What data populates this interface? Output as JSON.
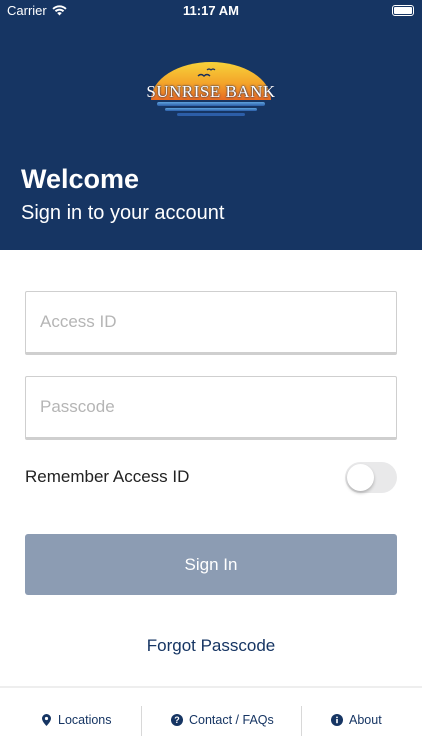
{
  "status_bar": {
    "carrier": "Carrier",
    "time": "11:17 AM"
  },
  "brand": {
    "name": "SUNRISE BANK"
  },
  "header": {
    "title": "Welcome",
    "subtitle": "Sign in to your account"
  },
  "form": {
    "access_id": {
      "placeholder": "Access ID",
      "value": ""
    },
    "passcode": {
      "placeholder": "Passcode",
      "value": ""
    },
    "remember_label": "Remember Access ID",
    "remember_on": false,
    "signin_label": "Sign In",
    "forgot_label": "Forgot Passcode"
  },
  "tabbar": {
    "items": [
      {
        "label": "Locations",
        "icon": "location-pin-icon"
      },
      {
        "label": "Contact / FAQs",
        "icon": "question-circle-icon"
      },
      {
        "label": "About",
        "icon": "info-circle-icon"
      }
    ]
  },
  "colors": {
    "navy": "#163563",
    "button_disabled": "#8c9cb3",
    "toggle_off": "#e9e9ea"
  }
}
